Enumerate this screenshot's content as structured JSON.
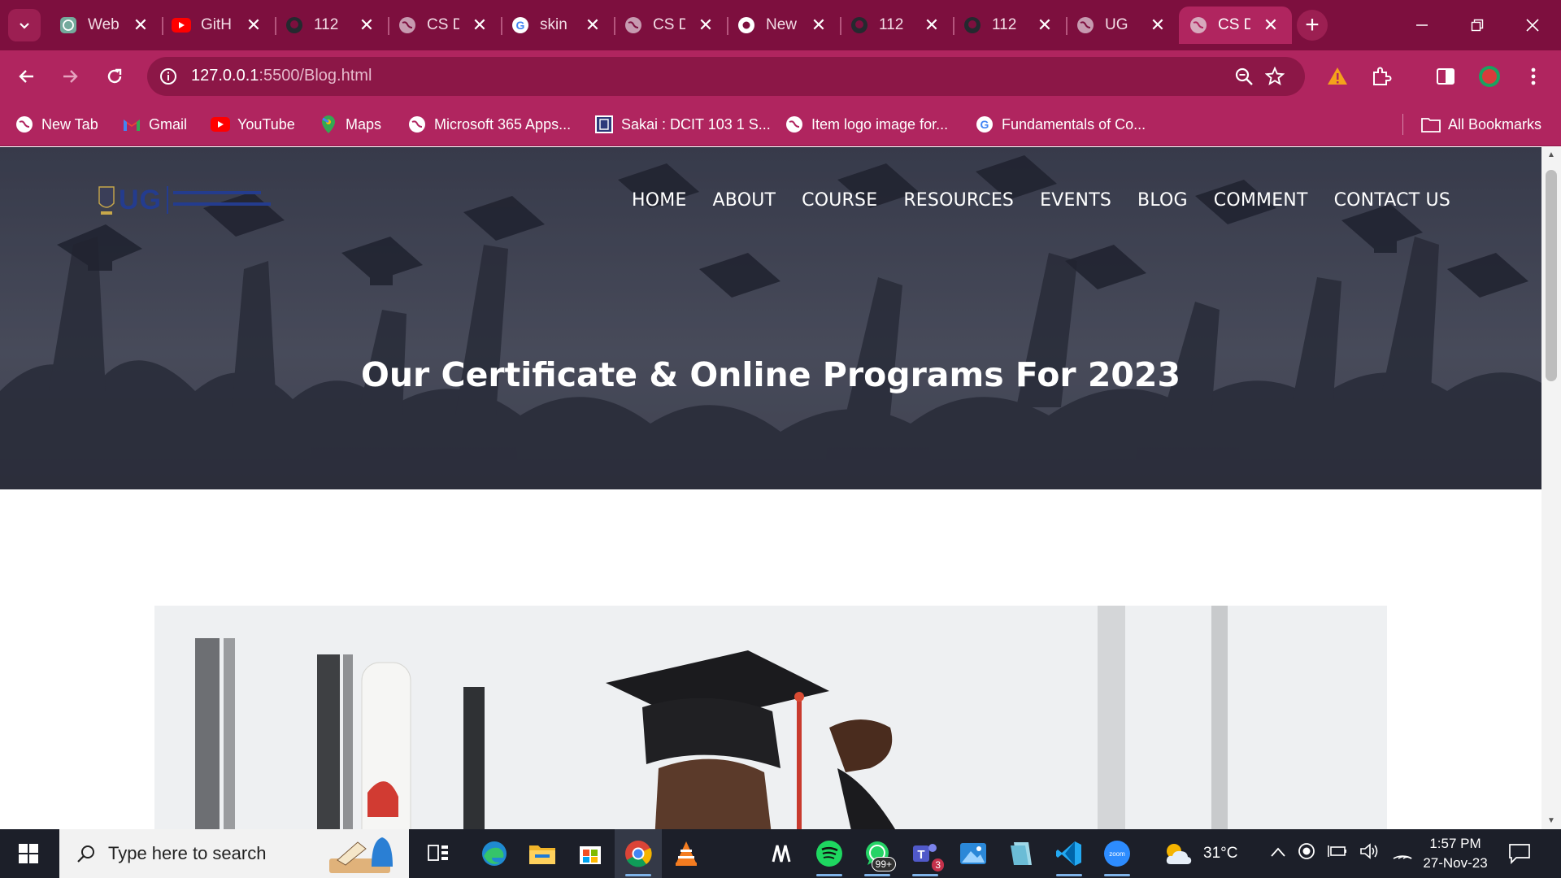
{
  "browser": {
    "tabs": [
      {
        "title": "Web",
        "icon": "chatgpt-icon"
      },
      {
        "title": "GitH",
        "icon": "youtube-icon"
      },
      {
        "title": "112",
        "icon": "github-icon"
      },
      {
        "title": "CS D",
        "icon": "globe-icon"
      },
      {
        "title": "skin",
        "icon": "google-icon"
      },
      {
        "title": "CS D",
        "icon": "globe-icon"
      },
      {
        "title": "New",
        "icon": "chrome-icon"
      },
      {
        "title": "112",
        "icon": "github-icon"
      },
      {
        "title": "112",
        "icon": "github-icon"
      },
      {
        "title": "UG",
        "icon": "globe-icon"
      },
      {
        "title": "CS D",
        "icon": "globe-icon",
        "active": true
      }
    ],
    "url_host": "127.0.0.1",
    "url_path": ":5500/Blog.html",
    "bookmarks": [
      {
        "label": "New Tab",
        "icon": "globe-icon"
      },
      {
        "label": "Gmail",
        "icon": "gmail-icon"
      },
      {
        "label": "YouTube",
        "icon": "youtube-icon"
      },
      {
        "label": "Maps",
        "icon": "maps-icon"
      },
      {
        "label": "Microsoft 365 Apps...",
        "icon": "globe-icon"
      },
      {
        "label": "Sakai : DCIT 103 1 S...",
        "icon": "sakai-icon"
      },
      {
        "label": "Item logo image for...",
        "icon": "globe-icon"
      },
      {
        "label": "Fundamentals of Co...",
        "icon": "google-icon"
      }
    ],
    "all_bookmarks": "All Bookmarks",
    "colors": {
      "frame": "#7d0f3e",
      "toolbar": "#b0255f",
      "omnibox": "#8c1747"
    }
  },
  "site": {
    "logo_abbr": "UG",
    "nav": [
      "HOME",
      "ABOUT",
      "COURSE",
      "RESOURCES",
      "EVENTS",
      "BLOG",
      "COMMENT",
      "CONTACT US"
    ],
    "hero_title": "Our Certificate & Online Programs For 2023"
  },
  "taskbar": {
    "search_placeholder": "Type here to search",
    "weather": "31°C",
    "time": "1:57 PM",
    "date": "27-Nov-23",
    "whatsapp_badge": "99+",
    "teams_badge": "3",
    "apps": [
      "task-view",
      "edge",
      "file-explorer",
      "microsoft-store",
      "chrome",
      "vlc",
      "mathpix",
      "spotify",
      "whatsapp",
      "teams",
      "photos",
      "notepad",
      "vscode",
      "zoom"
    ]
  }
}
